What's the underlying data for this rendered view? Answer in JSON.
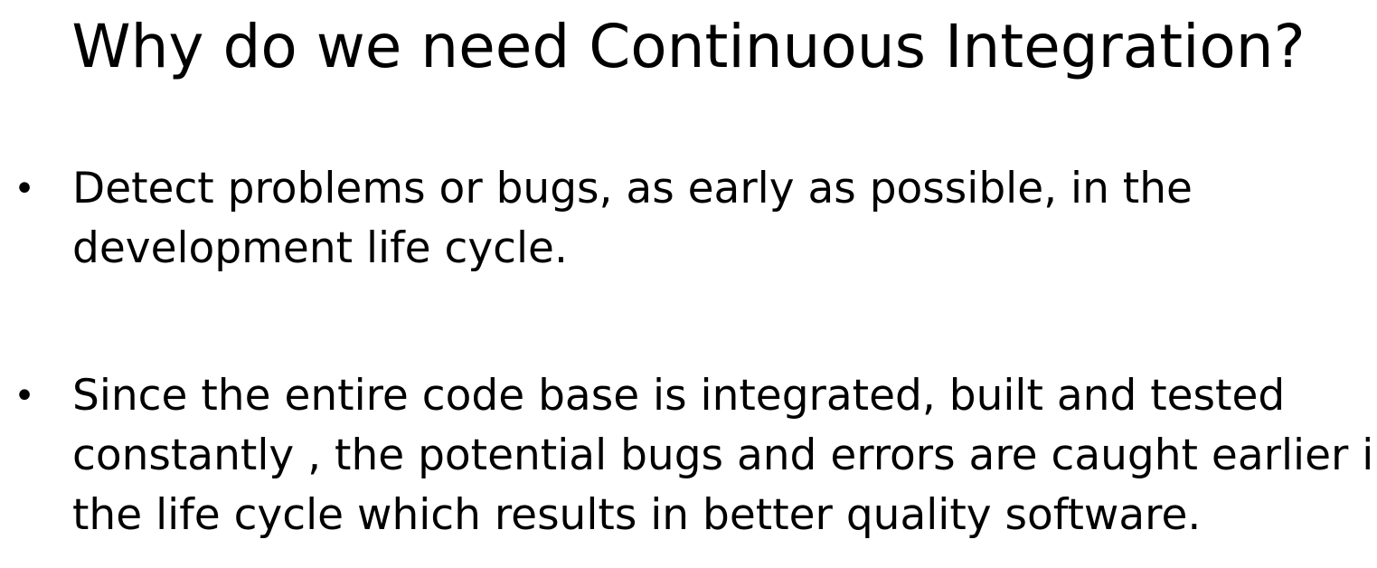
{
  "slide": {
    "title": "Why do we need Continuous Integration?",
    "bullet_glyph": "•",
    "bullets": [
      {
        "lines": [
          "Detect problems or bugs, as early as possible, in the",
          "development life cycle."
        ]
      },
      {
        "lines": [
          "Since the entire code base is integrated, built and tested",
          "constantly , the potential bugs and errors are caught earlier in",
          "the life cycle which results in better quality software."
        ]
      }
    ]
  }
}
